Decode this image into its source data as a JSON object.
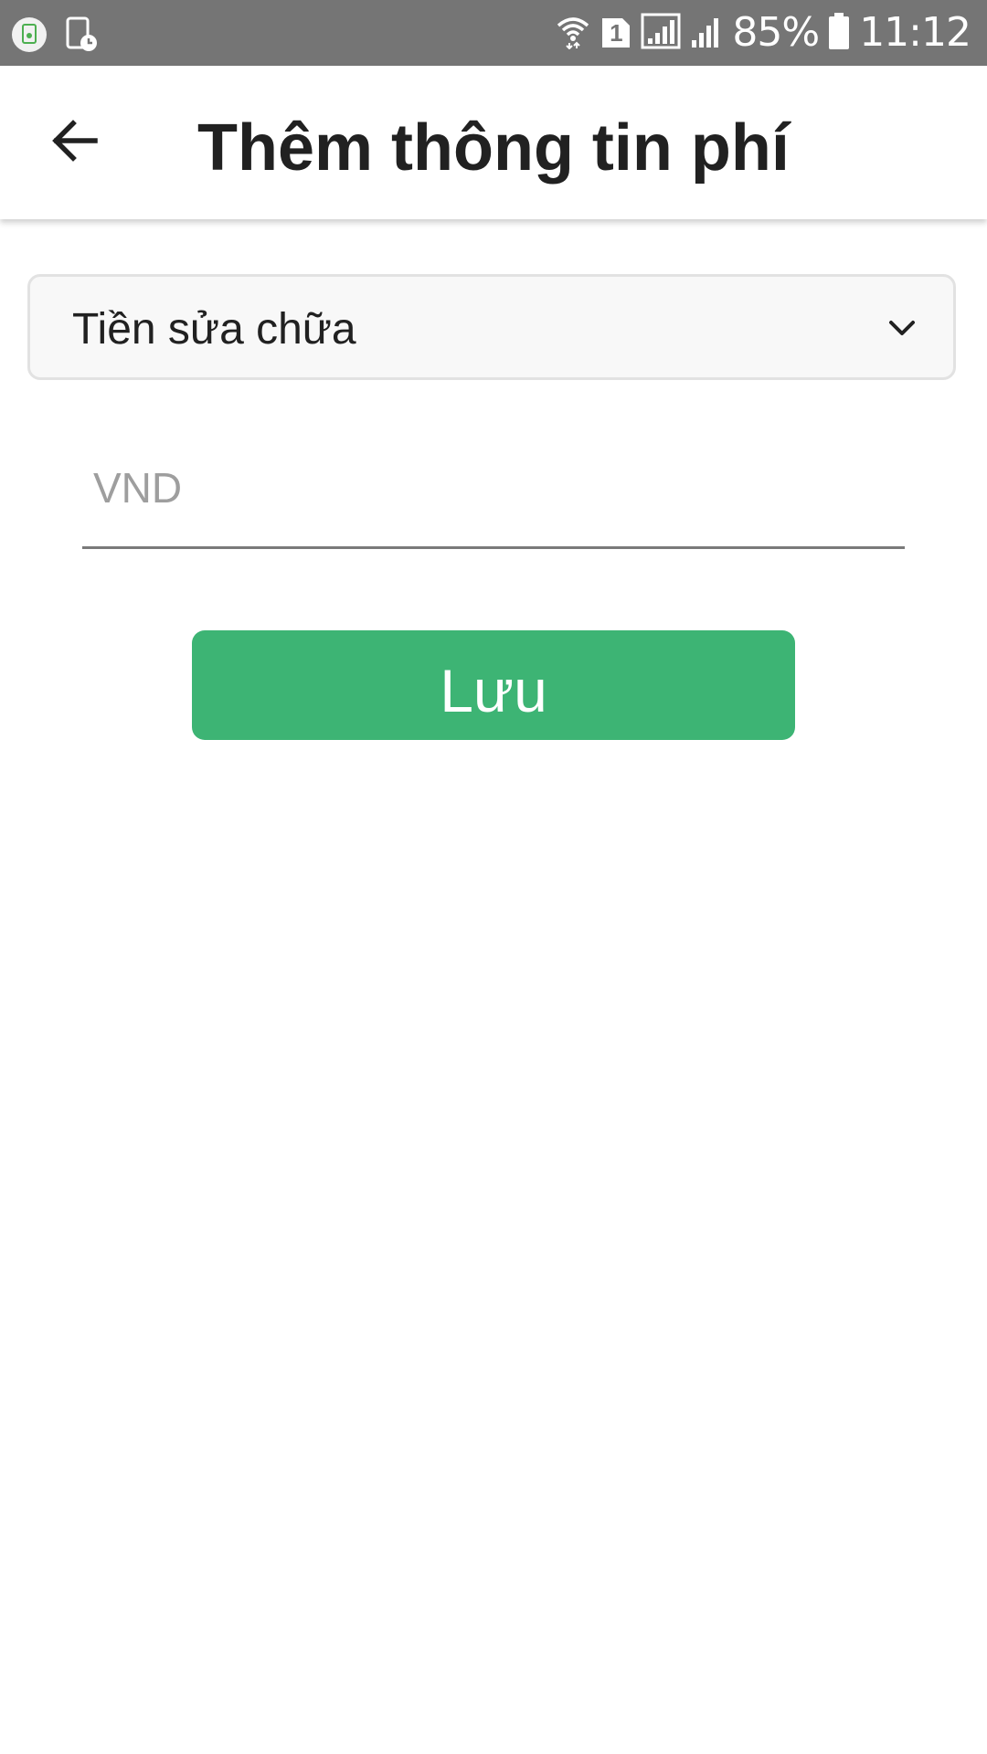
{
  "status_bar": {
    "left_icons": [
      "sim-notification-icon",
      "screen-timer-icon"
    ],
    "right_icons": [
      "wifi-icon",
      "sim-1-icon",
      "signal-icon",
      "signal-2-icon",
      "battery-icon"
    ],
    "sim_number": "1",
    "battery": "85%",
    "time": "11:12"
  },
  "app_bar": {
    "back_icon": "arrow-back-icon",
    "title": "Thêm thông tin phí"
  },
  "form": {
    "fee_type": {
      "selected": "Tiền sửa chữa",
      "icon": "chevron-down-icon"
    },
    "amount": {
      "value": "",
      "placeholder": "VND"
    },
    "save_label": "Lưu"
  },
  "colors": {
    "status_bar": "#757575",
    "primary_button": "#3db474",
    "title_text": "#212121",
    "placeholder": "#9e9e9e",
    "app_icon_green": "#4caf50"
  }
}
